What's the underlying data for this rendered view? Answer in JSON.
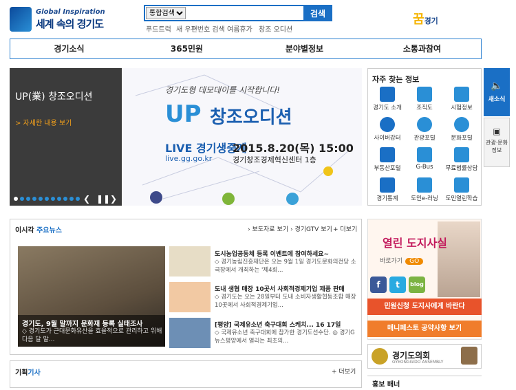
{
  "header": {
    "logo_sub": "Global Inspiration",
    "logo_main": "세계 속의 경기도",
    "search_select": "통합검색",
    "search_button": "검색",
    "quick_links": [
      "푸드트럭",
      "새 우편번호 검색",
      "여름휴가",
      "창조 오디션"
    ],
    "brand_right": "경기"
  },
  "gnb": [
    "경기소식",
    "365민원",
    "분야별정보",
    "소통과참여"
  ],
  "banner": {
    "title": "UP(業) 창조오디션",
    "more": "> 자세한 내용 보기",
    "caption": "경기도형 데모데이를 시작합니다!",
    "up": "UP",
    "headline": "창조오디션",
    "live": "LIVE 경기생중계",
    "date": "2015.8.20(목) 15:00",
    "url": "live.gg.go.kr",
    "place": "경기창조경제혁신센터 1층"
  },
  "frequent": {
    "title": "자주 찾는 정보",
    "items": [
      "경기도 소개",
      "조직도",
      "시험정보",
      "사이버강터",
      "관광포털",
      "문화포털",
      "부동산포털",
      "G-Bus",
      "무료법률상담",
      "경기통계",
      "도민e-러닝",
      "도민열린학습"
    ]
  },
  "side_tabs": [
    "새소식",
    "관광·문화 정보"
  ],
  "news": {
    "label": "이시각",
    "label_b": "주요뉴스",
    "links": [
      "보도자료 보기",
      "경기GTV 보기",
      "더보기"
    ],
    "main_title": "경기도, 9월 말까지 문화재 등록 실태조사",
    "main_desc": "◇ 경기도가 근대문화유산을 효율적으로 관리하고 위해 다음 달 말...",
    "items": [
      {
        "title": "도시농업공동체 등록 이벤트에 참여하세요~",
        "desc": "◇ 경기농림진흥재단은 오는 9월 1일 경기도문화의전당 소극장에서 개최하는 '제4회..."
      },
      {
        "title": "도내 생협 매장 10곳서 사회적경제기업 제품 판매",
        "desc": "◇ 경기도는 오는 28일부터 도내 소비자생활협동조합 매장 10곳에서 사회적경제기업..."
      },
      {
        "title": "[평양] 국제유소년 축구대회 스케치... 16 17일",
        "desc": "◇ 국제유소년 축구대회에 참가한 경기도선수단. ◎ 경기G뉴스평양에서 열리는 최초의..."
      }
    ]
  },
  "promo": {
    "title": "열린 도지사실",
    "go": "바로가기",
    "go_btn": "GO",
    "sns": [
      "f",
      "t",
      "blog"
    ],
    "btn1": "민원신청 도지사에게 바란다",
    "btn2": "매니페스토 공약사항 보기"
  },
  "assembly": {
    "title": "경기도의회",
    "sub": "GYEONGGIDO ASSEMBLY"
  },
  "hongbo": "홍보 배너",
  "gihoek": {
    "label": "기획",
    "label_b": "기사",
    "more": "더보기"
  }
}
